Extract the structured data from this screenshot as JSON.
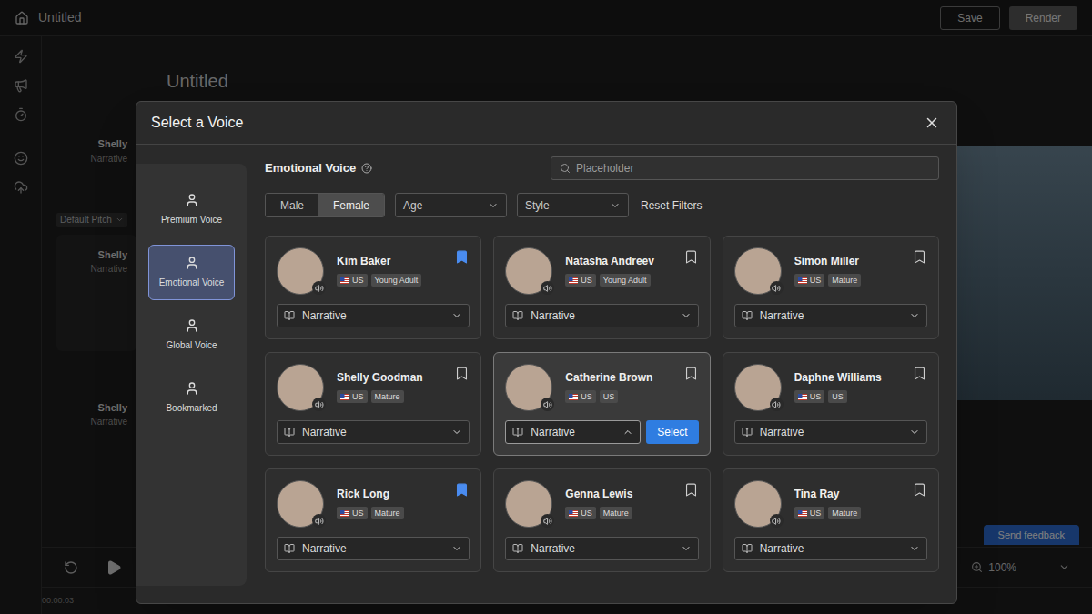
{
  "app": {
    "title": "Untitled",
    "buttons": [
      {
        "label": "Save"
      },
      {
        "label": "Render"
      }
    ],
    "heading": "Untitled",
    "tracks": [
      {
        "name": "Shelly",
        "style": "Narrative"
      },
      {
        "name": "Shelly",
        "style": "Narrative"
      },
      {
        "name": "Shelly",
        "style": "Narrative"
      }
    ],
    "pitch": "Default Pitch",
    "feedback": "Send feedback",
    "zoom": "100%",
    "timecode": "00:00:03"
  },
  "dialog": {
    "title": "Select a Voice",
    "categories": [
      {
        "label": "Premium Voice",
        "selected": false
      },
      {
        "label": "Emotional Voice",
        "selected": true
      },
      {
        "label": "Global Voice",
        "selected": false
      },
      {
        "label": "Bookmarked",
        "selected": false
      }
    ],
    "section": {
      "title": "Emotional Voice"
    },
    "search": {
      "placeholder": "Placeholder"
    },
    "gender": [
      {
        "label": "Male",
        "selected": false
      },
      {
        "label": "Female",
        "selected": true
      }
    ],
    "filters": [
      {
        "label": "Age"
      },
      {
        "label": "Style"
      }
    ],
    "reset": "Reset Filters",
    "select_button": "Select",
    "voices": [
      {
        "name": "Kim Baker",
        "tags": [
          {
            "label": "US",
            "kind": "flag"
          },
          {
            "label": "Young Adult",
            "kind": "plain"
          }
        ],
        "bookmarked": true,
        "style": "Narrative",
        "active": false,
        "expanded": false
      },
      {
        "name": "Natasha Andreev",
        "tags": [
          {
            "label": "US",
            "kind": "flag"
          },
          {
            "label": "Young Adult",
            "kind": "plain"
          }
        ],
        "bookmarked": false,
        "style": "Narrative",
        "active": false,
        "expanded": false
      },
      {
        "name": "Simon Miller",
        "tags": [
          {
            "label": "US",
            "kind": "flag"
          },
          {
            "label": "Mature",
            "kind": "plain"
          }
        ],
        "bookmarked": false,
        "style": "Narrative",
        "active": false,
        "expanded": false
      },
      {
        "name": "Shelly Goodman",
        "tags": [
          {
            "label": "US",
            "kind": "flag"
          },
          {
            "label": "Mature",
            "kind": "plain"
          }
        ],
        "bookmarked": false,
        "style": "Narrative",
        "active": false,
        "expanded": false
      },
      {
        "name": "Catherine Brown",
        "tags": [
          {
            "label": "US",
            "kind": "flag"
          },
          {
            "label": "US",
            "kind": "plain"
          }
        ],
        "bookmarked": false,
        "style": "Narrative",
        "active": true,
        "expanded": true
      },
      {
        "name": "Daphne Williams",
        "tags": [
          {
            "label": "US",
            "kind": "flag"
          },
          {
            "label": "US",
            "kind": "plain"
          }
        ],
        "bookmarked": false,
        "style": "Narrative",
        "active": false,
        "expanded": false
      },
      {
        "name": "Rick Long",
        "tags": [
          {
            "label": "US",
            "kind": "flag"
          },
          {
            "label": "Mature",
            "kind": "plain"
          }
        ],
        "bookmarked": true,
        "style": "Narrative",
        "active": false,
        "expanded": false
      },
      {
        "name": "Genna Lewis",
        "tags": [
          {
            "label": "US",
            "kind": "flag"
          },
          {
            "label": "Mature",
            "kind": "plain"
          }
        ],
        "bookmarked": false,
        "style": "Narrative",
        "active": false,
        "expanded": false
      },
      {
        "name": "Tina Ray",
        "tags": [
          {
            "label": "US",
            "kind": "flag"
          },
          {
            "label": "Mature",
            "kind": "plain"
          }
        ],
        "bookmarked": false,
        "style": "Narrative",
        "active": false,
        "expanded": false
      }
    ]
  }
}
